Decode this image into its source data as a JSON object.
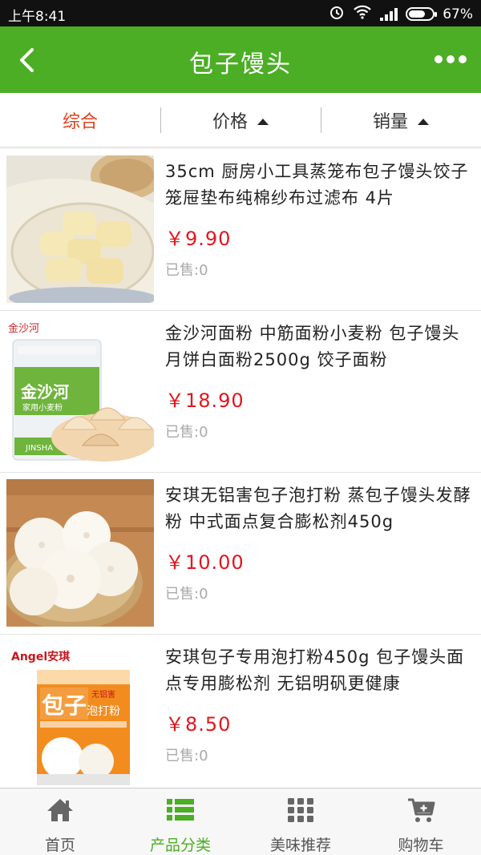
{
  "status_bar": {
    "time": "上午8:41",
    "battery": "67%"
  },
  "header": {
    "title": "包子馒头"
  },
  "sort_tabs": [
    {
      "label": "综合"
    },
    {
      "label": "价格"
    },
    {
      "label": "销量"
    }
  ],
  "products": [
    {
      "title": "35cm 厨房小工具蒸笼布包子馒头饺子笼屉垫布纯棉纱布过滤布 4片",
      "price": "￥9.90",
      "sold": "已售:0"
    },
    {
      "title": "金沙河面粉 中筋面粉小麦粉 包子馒头月饼白面粉2500g 饺子面粉",
      "price": "￥18.90",
      "sold": "已售:0",
      "image_text": "金沙河",
      "bag_text": "金沙河",
      "bag_sub": "家用小麦粉",
      "bag_brand": "JINSHA"
    },
    {
      "title": "安琪无铝害包子泡打粉 蒸包子馒头发酵粉 中式面点复合膨松剂450g",
      "price": "￥10.00",
      "sold": "已售:0"
    },
    {
      "title": "安琪包子专用泡打粉450g 包子馒头面点专用膨松剂 无铝明矾更健康",
      "price": "￥8.50",
      "sold": "已售:0",
      "image_text": "Angel安琪",
      "box_big": "包子",
      "box_sub": "泡打粉",
      "box_tag": "无铝害"
    }
  ],
  "tabbar": [
    {
      "label": "首页",
      "icon": "home-icon"
    },
    {
      "label": "产品分类",
      "icon": "list-icon"
    },
    {
      "label": "美味推荐",
      "icon": "grid-icon"
    },
    {
      "label": "购物车",
      "icon": "cart-icon"
    }
  ],
  "colors": {
    "brand": "#4cae25",
    "price": "#e0171e",
    "active_sort": "#e0421f"
  }
}
